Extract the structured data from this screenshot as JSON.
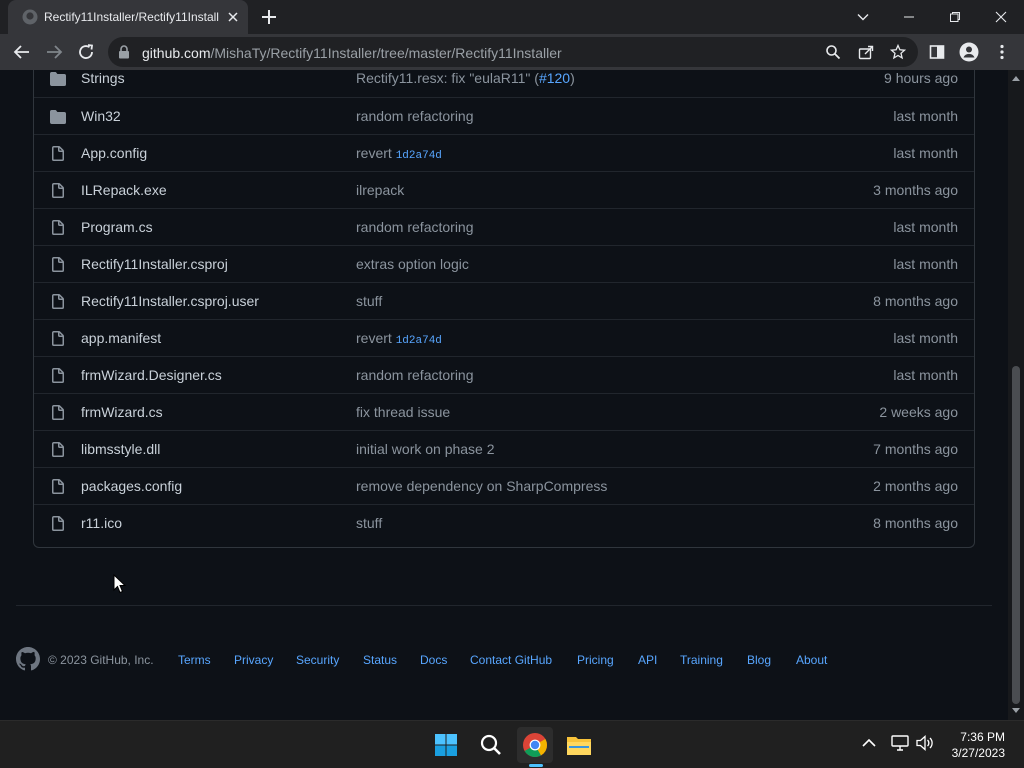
{
  "browser": {
    "tab_title": "Rectify11Installer/Rectify11Install",
    "url_host": "github.com",
    "url_path": "/MishaTy/Rectify11Installer/tree/master/Rectify11Installer"
  },
  "files": [
    {
      "type": "folder",
      "name": "Strings",
      "message": "Rectify11.resx: fix \"eulaR11\" (",
      "message_link": "#120",
      "message_suffix": ")",
      "age": "9 hours ago"
    },
    {
      "type": "folder",
      "name": "Win32",
      "message": "random refactoring",
      "age": "last month"
    },
    {
      "type": "file",
      "name": "App.config",
      "message": "revert ",
      "sha": "1d2a74d",
      "age": "last month"
    },
    {
      "type": "file",
      "name": "ILRepack.exe",
      "message": "ilrepack",
      "age": "3 months ago"
    },
    {
      "type": "file",
      "name": "Program.cs",
      "message": "random refactoring",
      "age": "last month"
    },
    {
      "type": "file",
      "name": "Rectify11Installer.csproj",
      "message": "extras option logic",
      "age": "last month"
    },
    {
      "type": "file",
      "name": "Rectify11Installer.csproj.user",
      "message": "stuff",
      "age": "8 months ago"
    },
    {
      "type": "file",
      "name": "app.manifest",
      "message": "revert ",
      "sha": "1d2a74d",
      "age": "last month"
    },
    {
      "type": "file",
      "name": "frmWizard.Designer.cs",
      "message": "random refactoring",
      "age": "last month"
    },
    {
      "type": "file",
      "name": "frmWizard.cs",
      "message": "fix thread issue",
      "age": "2 weeks ago"
    },
    {
      "type": "file",
      "name": "libmsstyle.dll",
      "message": "initial work on phase 2",
      "age": "7 months ago"
    },
    {
      "type": "file",
      "name": "packages.config",
      "message": "remove dependency on SharpCompress",
      "age": "2 months ago"
    },
    {
      "type": "file",
      "name": "r11.ico",
      "message": "stuff",
      "age": "8 months ago"
    }
  ],
  "footer": {
    "copyright": "© 2023 GitHub, Inc.",
    "links": [
      "Terms",
      "Privacy",
      "Security",
      "Status",
      "Docs",
      "Contact GitHub",
      "Pricing",
      "API",
      "Training",
      "Blog",
      "About"
    ]
  },
  "taskbar": {
    "time": "7:36 PM",
    "date": "3/27/2023",
    "apps": [
      "start-icon",
      "search-icon",
      "chrome-icon",
      "file-explorer-icon"
    ]
  },
  "colors": {
    "page_bg": "#0d1117",
    "link": "#58a6ff",
    "muted": "#8b949e",
    "text": "#c9d1d9",
    "border": "#30363d"
  }
}
